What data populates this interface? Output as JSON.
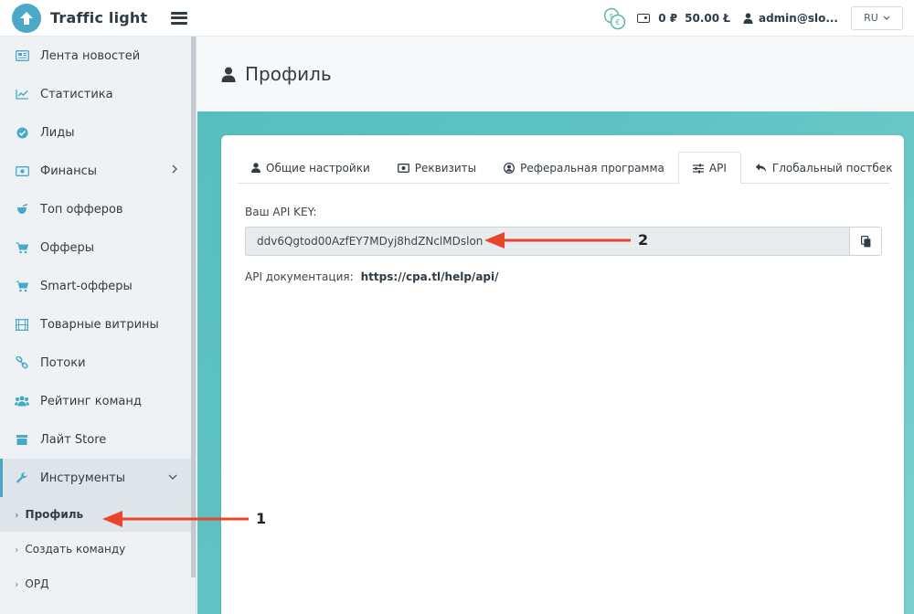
{
  "header": {
    "app_name": "Traffic light",
    "balance_value_1": "0 ₽",
    "balance_value_2": "50.00 Ł",
    "user_name": "admin@slo...",
    "language": "RU"
  },
  "sidebar": {
    "items": [
      {
        "label": "Лента новостей",
        "icon": "newspaper-icon"
      },
      {
        "label": "Статистика",
        "icon": "line-chart-icon"
      },
      {
        "label": "Лиды",
        "icon": "check-circle-icon"
      },
      {
        "label": "Финансы",
        "icon": "money-icon"
      },
      {
        "label": "Топ офферов",
        "icon": "trophy-icon"
      },
      {
        "label": "Офферы",
        "icon": "cart-icon"
      },
      {
        "label": "Smart-офферы",
        "icon": "cart-icon"
      },
      {
        "label": "Товарные витрины",
        "icon": "film-icon"
      },
      {
        "label": "Потоки",
        "icon": "link-icon"
      },
      {
        "label": "Рейтинг команд",
        "icon": "users-icon"
      },
      {
        "label": "Лайт Store",
        "icon": "store-icon"
      },
      {
        "label": "Инструменты",
        "icon": "wrench-icon"
      }
    ],
    "subitems": [
      {
        "label": "Профиль"
      },
      {
        "label": "Создать команду"
      },
      {
        "label": "ОРД"
      }
    ]
  },
  "page": {
    "title": "Профиль"
  },
  "tabs": [
    {
      "label": "Общие настройки",
      "icon": "user-icon"
    },
    {
      "label": "Реквизиты",
      "icon": "money-icon"
    },
    {
      "label": "Реферальная программа",
      "icon": "user-circle-icon"
    },
    {
      "label": "API",
      "icon": "sliders-icon"
    },
    {
      "label": "Глобальный постбек",
      "icon": "reply-icon"
    }
  ],
  "api": {
    "key_label": "Ваш API KEY:",
    "key_value": "ddv6Qgtod00AzfEY7MDyj8hdZNclMDslon",
    "doc_label": "API документация:",
    "doc_link": "https://cpa.tl/help/api/"
  },
  "annotations": {
    "arrow_1_label": "1",
    "arrow_2_label": "2",
    "color": "#e8452c"
  },
  "colors": {
    "accent": "#4aa9c9",
    "teal_band": "#5fc3c4"
  }
}
